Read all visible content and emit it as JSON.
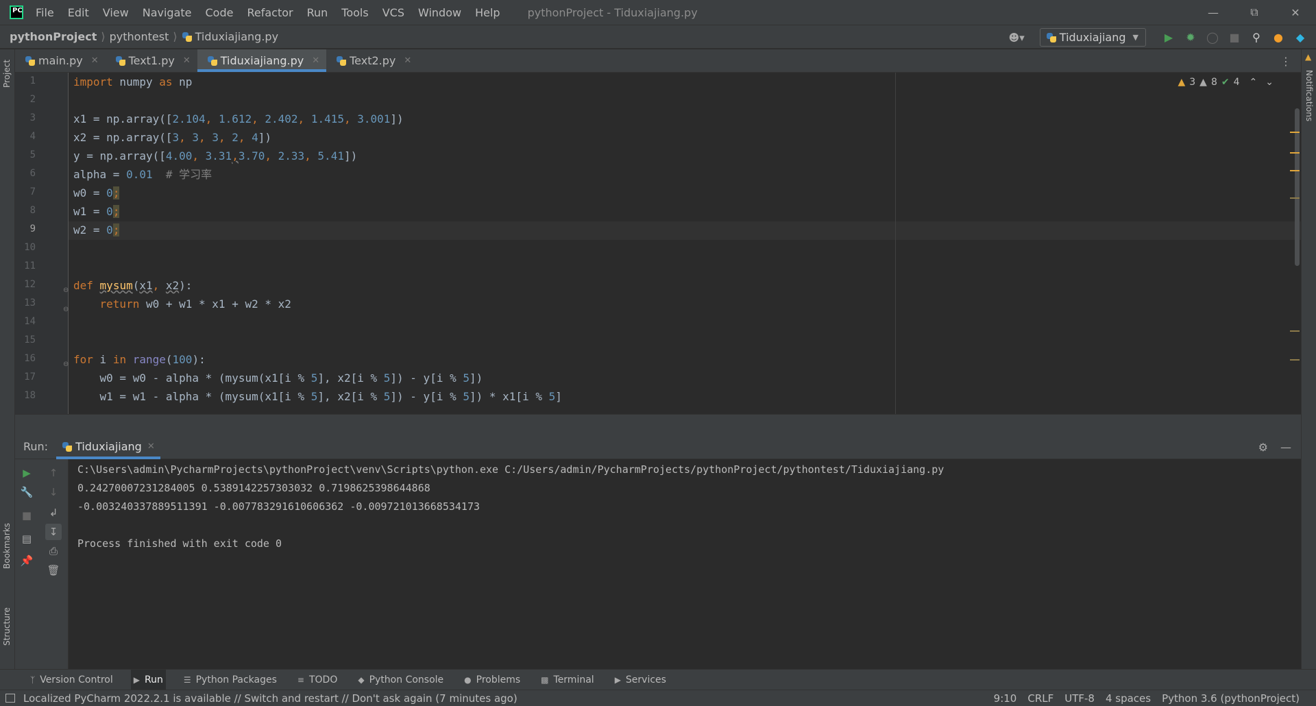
{
  "menu": {
    "items": [
      "File",
      "Edit",
      "View",
      "Navigate",
      "Code",
      "Refactor",
      "Run",
      "Tools",
      "VCS",
      "Window",
      "Help"
    ],
    "window_title": "pythonProject - Tiduxiajiang.py"
  },
  "breadcrumb": {
    "project": "pythonProject",
    "folder": "pythontest",
    "file": "Tiduxiajiang.py"
  },
  "run_config": {
    "name": "Tiduxiajiang"
  },
  "tabs": [
    {
      "label": "main.py"
    },
    {
      "label": "Text1.py"
    },
    {
      "label": "Tiduxiajiang.py"
    },
    {
      "label": "Text2.py"
    }
  ],
  "inspections": {
    "warnings": "3",
    "weak_warnings": "8",
    "typos": "4"
  },
  "editor": {
    "current_line": 9,
    "line_numbers": [
      "1",
      "2",
      "3",
      "4",
      "5",
      "6",
      "7",
      "8",
      "9",
      "10",
      "11",
      "12",
      "13",
      "14",
      "15",
      "16",
      "17",
      "18"
    ],
    "code": {
      "l1": {
        "kw1": "import",
        "mod": " numpy ",
        "kw2": "as",
        "alias": " np"
      },
      "l3": {
        "a": "x1 = np.array([",
        "n1": "2.104",
        "s1": ", ",
        "n2": "1.612",
        "s2": ", ",
        "n3": "2.402",
        "s3": ", ",
        "n4": "1.415",
        "s4": ", ",
        "n5": "3.001",
        "e": "])"
      },
      "l4": {
        "a": "x2 = np.array([",
        "n1": "3",
        "s1": ", ",
        "n2": "3",
        "s2": ", ",
        "n3": "3",
        "s3": ", ",
        "n4": "2",
        "s4": ", ",
        "n5": "4",
        "e": "])"
      },
      "l5": {
        "a": "y = np.array([",
        "n1": "4.00",
        "s1": ", ",
        "n2": "3.31",
        "s2": ",",
        "n3": "3.70",
        "s3": ", ",
        "n4": "2.33",
        "s4": ", ",
        "n5": "5.41",
        "e": "])"
      },
      "l6": {
        "a": "alpha = ",
        "n": "0.01",
        "c": "  # 学习率"
      },
      "l7": {
        "a": "w0 = ",
        "n": "0",
        "semi": ";"
      },
      "l8": {
        "a": "w1 = ",
        "n": "0",
        "semi": ";"
      },
      "l9": {
        "a": "w2 = ",
        "n": "0",
        "semi": ";"
      },
      "l12": {
        "kw": "def",
        "fn": "mysum",
        "p1": "(",
        "a1": "x1",
        "p2": ", ",
        "a2": "x2",
        "p3": "):"
      },
      "l13": {
        "indent": "    ",
        "kw": "return",
        "rest": " w0 + w1 * x1 + w2 * x2"
      },
      "l16": {
        "kw1": "for",
        "v": " i ",
        "kw2": "in",
        "sp": " ",
        "bi": "range",
        "p1": "(",
        "n": "100",
        "p2": "):"
      },
      "l17": {
        "a": "    w0 = w0 - alpha * (mysum(x1[i % ",
        "n1": "5",
        "b": "], x2[i % ",
        "n2": "5",
        "c": "]) - y[i % ",
        "n3": "5",
        "d": "])"
      },
      "l18": {
        "a": "    w1 = w1 - alpha * (mysum(x1[i % ",
        "n1": "5",
        "b": "], x2[i % ",
        "n2": "5",
        "c": "]) - y[i % ",
        "n3": "5",
        "d": "]) * x1[i % ",
        "n4": "5",
        "e": "]"
      }
    }
  },
  "run_panel": {
    "label": "Run:",
    "tab": "Tiduxiajiang",
    "output": [
      "C:\\Users\\admin\\PycharmProjects\\pythonProject\\venv\\Scripts\\python.exe C:/Users/admin/PycharmProjects/pythonProject/pythontest/Tiduxiajiang.py",
      "0.24270007231284005 0.5389142257303032 0.7198625398644868",
      "-0.003240337889511391 -0.007783291610606362 -0.009721013668534173",
      "",
      "Process finished with exit code 0"
    ]
  },
  "side_labels": {
    "project": "Project",
    "bookmarks": "Bookmarks",
    "structure": "Structure",
    "notifications": "Notifications"
  },
  "bottom_tools": [
    {
      "label": "Version Control",
      "icon": "branch-icon"
    },
    {
      "label": "Run",
      "icon": "play-icon"
    },
    {
      "label": "Python Packages",
      "icon": "layers-icon"
    },
    {
      "label": "TODO",
      "icon": "list-icon"
    },
    {
      "label": "Python Console",
      "icon": "python-icon"
    },
    {
      "label": "Problems",
      "icon": "info-icon"
    },
    {
      "label": "Terminal",
      "icon": "terminal-icon"
    },
    {
      "label": "Services",
      "icon": "services-icon"
    }
  ],
  "status": {
    "message": "Localized PyCharm 2022.2.1 is available // Switch and restart // Don't ask again (7 minutes ago)",
    "position": "9:10",
    "line_sep": "CRLF",
    "encoding": "UTF-8",
    "indent": "4 spaces",
    "interpreter": "Python 3.6 (pythonProject)"
  },
  "colors": {
    "accent": "#4a88c7",
    "keyword": "#cc7832",
    "number": "#6897bb",
    "function": "#ffc66d",
    "warning": "#e0a63b"
  }
}
